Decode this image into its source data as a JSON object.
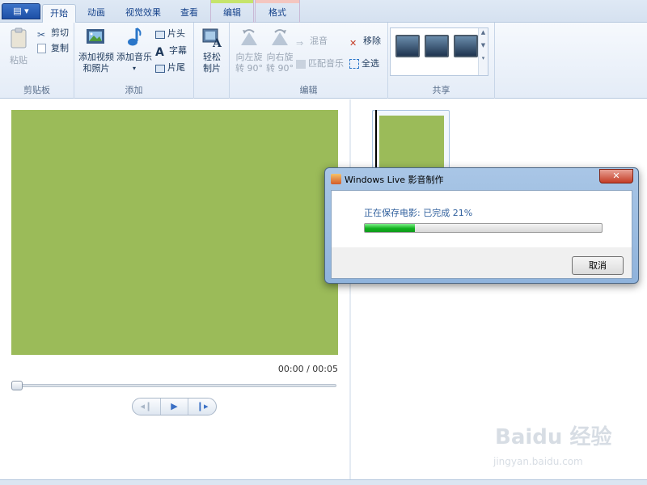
{
  "tabs": {
    "home": "开始",
    "animations": "动画",
    "visual_effects": "视觉效果",
    "view": "查看",
    "edit": "编辑",
    "format": "格式"
  },
  "ribbon": {
    "clipboard": {
      "label": "剪贴板",
      "paste": "粘贴",
      "cut": "剪切",
      "copy": "复制"
    },
    "add": {
      "label": "添加",
      "add_video_line1": "添加视频",
      "add_video_line2": "和照片",
      "add_music": "添加音乐",
      "title": "片头",
      "caption": "字幕",
      "credits": "片尾"
    },
    "automovie": {
      "line1": "轻松",
      "line2": "制片"
    },
    "editing": {
      "label": "编辑",
      "rotate_left_line1": "向左旋",
      "rotate_left_line2": "转 90°",
      "rotate_right_line1": "向右旋",
      "rotate_right_line2": "转 90°",
      "snapshot": "混音",
      "fit_music": "匹配音乐",
      "remove": "移除",
      "select_all": "全选"
    },
    "share": {
      "label": "共享"
    }
  },
  "player": {
    "time": "00:00 / 00:05",
    "progress_fraction": 0.0
  },
  "dialog": {
    "title": "Windows Live 影音制作",
    "close": "✕",
    "message": "正在保存电影: 已完成 21%",
    "progress_percent": 21,
    "cancel": "取消"
  },
  "watermark": {
    "brand": "Baidu 经验",
    "url": "jingyan.baidu.com"
  },
  "colors": {
    "video_placeholder": "#9bbb59",
    "progress_fill": "#12b21f",
    "edit_tab_accent": "#c6e46b",
    "format_tab_accent": "#f4c6c0"
  }
}
